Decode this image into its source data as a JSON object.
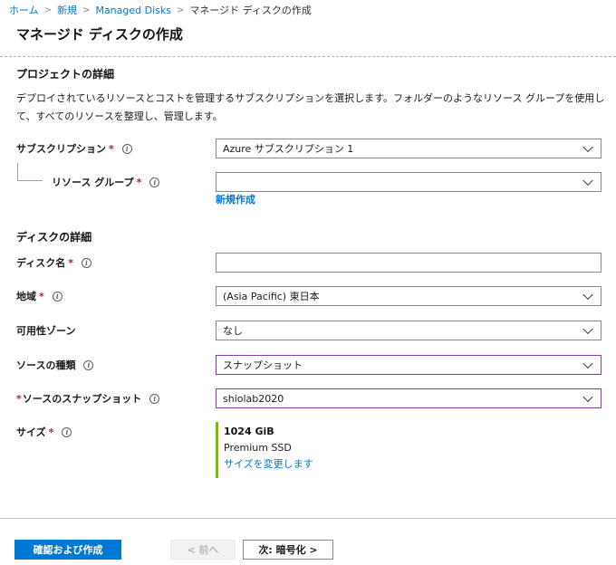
{
  "breadcrumb": {
    "items": [
      "ホーム",
      "新規",
      "Managed Disks",
      "マネージド ディスクの作成"
    ]
  },
  "page": {
    "title": "マネージド ディスクの作成"
  },
  "project": {
    "heading": "プロジェクトの詳細",
    "description": "デプロイされているリソースとコストを管理するサブスクリプションを選択します。フォルダーのようなリソース グループを使用して、すべてのリソースを整理し、管理します。",
    "subscription": {
      "label": "サブスクリプション",
      "required": "*",
      "value": "Azure サブスクリプション 1"
    },
    "resource_group": {
      "label": "リソース グループ",
      "required": "*",
      "value": "",
      "create_link": "新規作成"
    }
  },
  "disk": {
    "heading": "ディスクの詳細",
    "name": {
      "label": "ディスク名",
      "required": "*",
      "value": ""
    },
    "region": {
      "label": "地域",
      "required": "*",
      "value": "(Asia Pacific) 東日本"
    },
    "availability_zone": {
      "label": "可用性ゾーン",
      "value": "なし"
    },
    "source_type": {
      "label": "ソースの種類",
      "value": "スナップショット"
    },
    "source_snapshot": {
      "label": "ソースのスナップショット",
      "required": "*",
      "value": "shiolab2020"
    },
    "size": {
      "label": "サイズ",
      "required": "*",
      "value": "1024 GiB",
      "tier": "Premium SSD",
      "change_link": "サイズを変更します"
    }
  },
  "footer": {
    "review_create": "確認および作成",
    "previous": "< 前へ",
    "next": "次: 暗号化 >"
  },
  "icons": {
    "info": "info-icon",
    "chevron": "chevron-down-icon"
  },
  "colors": {
    "accent": "#0078d4",
    "required": "#a4262c",
    "focus_border": "#8a3ba3",
    "size_bar": "#7fba00"
  }
}
